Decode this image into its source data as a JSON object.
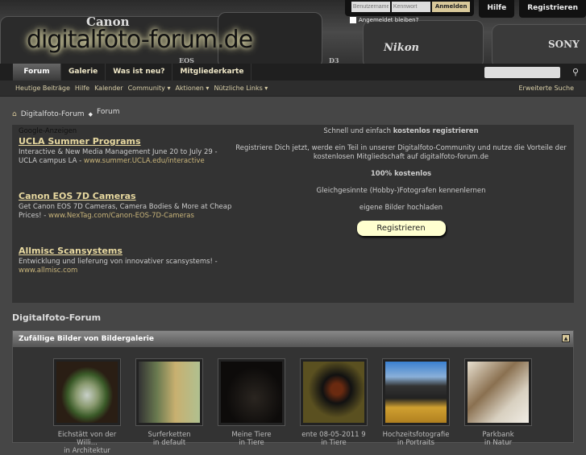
{
  "header": {
    "logo": "digitalfoto-forum.de",
    "brands": [
      "Canon",
      "EOS",
      "Nikon",
      "SONY",
      "D3"
    ]
  },
  "login": {
    "username_placeholder": "Benutzername",
    "password_placeholder": "Kennwort",
    "login_button": "Anmelden",
    "remember": "Angemeldet bleiben?",
    "help": "Hilfe",
    "register": "Registrieren"
  },
  "nav": {
    "tabs": [
      "Forum",
      "Galerie",
      "Was ist neu?",
      "Mitgliederkarte"
    ]
  },
  "subnav": {
    "items": [
      "Heutige Beiträge",
      "Hilfe",
      "Kalender",
      "Community ▾",
      "Aktionen ▾",
      "Nützliche Links ▾"
    ],
    "advanced_search": "Erweiterte Suche"
  },
  "breadcrumb": {
    "home": "Digitalfoto-Forum",
    "current": "Forum"
  },
  "ads": {
    "label": "Google-Anzeigen",
    "items": [
      {
        "title": "UCLA Summer Programs",
        "desc": "Interactive & New Media Management June 20 to July 29 - UCLA campus LA - ",
        "url": "www.summer.UCLA.edu/interactive"
      },
      {
        "title": "Canon EOS 7D Cameras",
        "desc": "Get Canon EOS 7D Cameras, Camera Bodies & More at Cheap Prices! - ",
        "url": "www.NexTag.com/Canon-EOS-7D-Cameras"
      },
      {
        "title": "Allmisc Scansystems",
        "desc": "Entwicklung und lieferung von innovativer scansystems! - ",
        "url": "www.allmisc.com"
      }
    ]
  },
  "register": {
    "line1a": "Schnell und einfach ",
    "line1b": "kostenlos registrieren",
    "line2": "Registriere Dich jetzt, werde ein Teil in unserer Digitalfoto-Community und nutze die Vorteile der kostenlosen Mitgliedschaft auf digitalfoto-forum.de",
    "line3": "100% kostenlos",
    "line4": "Gleichgesinnte (Hobby-)Fotografen kennenlernen",
    "line5": "eigene Bilder hochladen",
    "button": "Registrieren"
  },
  "section_title": "Digitalfoto-Forum",
  "gallery": {
    "title": "Zufällige Bilder von Bildergalerie",
    "items": [
      {
        "title": "Eichstätt von der Willi...",
        "cat": "in Architektur"
      },
      {
        "title": "Surferketten",
        "cat": "in default"
      },
      {
        "title": "Meine Tiere",
        "cat": "in Tiere"
      },
      {
        "title": "ente 08-05-2011 9",
        "cat": "in Tiere"
      },
      {
        "title": "Hochzeitsfotografie",
        "cat": "in Portraits"
      },
      {
        "title": "Parkbank",
        "cat": "in Natur"
      }
    ]
  }
}
